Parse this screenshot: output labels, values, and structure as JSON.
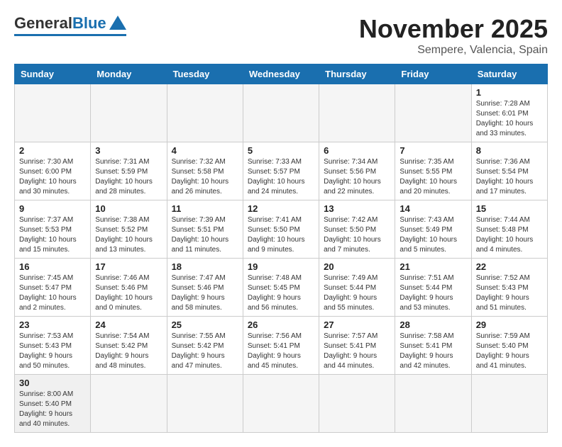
{
  "logo": {
    "general": "General",
    "blue": "Blue"
  },
  "header": {
    "title": "November 2025",
    "subtitle": "Sempere, Valencia, Spain"
  },
  "weekdays": [
    "Sunday",
    "Monday",
    "Tuesday",
    "Wednesday",
    "Thursday",
    "Friday",
    "Saturday"
  ],
  "weeks": [
    [
      {
        "day": "",
        "info": ""
      },
      {
        "day": "",
        "info": ""
      },
      {
        "day": "",
        "info": ""
      },
      {
        "day": "",
        "info": ""
      },
      {
        "day": "",
        "info": ""
      },
      {
        "day": "",
        "info": ""
      },
      {
        "day": "1",
        "info": "Sunrise: 7:28 AM\nSunset: 6:01 PM\nDaylight: 10 hours and 33 minutes."
      }
    ],
    [
      {
        "day": "2",
        "info": "Sunrise: 7:30 AM\nSunset: 6:00 PM\nDaylight: 10 hours and 30 minutes."
      },
      {
        "day": "3",
        "info": "Sunrise: 7:31 AM\nSunset: 5:59 PM\nDaylight: 10 hours and 28 minutes."
      },
      {
        "day": "4",
        "info": "Sunrise: 7:32 AM\nSunset: 5:58 PM\nDaylight: 10 hours and 26 minutes."
      },
      {
        "day": "5",
        "info": "Sunrise: 7:33 AM\nSunset: 5:57 PM\nDaylight: 10 hours and 24 minutes."
      },
      {
        "day": "6",
        "info": "Sunrise: 7:34 AM\nSunset: 5:56 PM\nDaylight: 10 hours and 22 minutes."
      },
      {
        "day": "7",
        "info": "Sunrise: 7:35 AM\nSunset: 5:55 PM\nDaylight: 10 hours and 20 minutes."
      },
      {
        "day": "8",
        "info": "Sunrise: 7:36 AM\nSunset: 5:54 PM\nDaylight: 10 hours and 17 minutes."
      }
    ],
    [
      {
        "day": "9",
        "info": "Sunrise: 7:37 AM\nSunset: 5:53 PM\nDaylight: 10 hours and 15 minutes."
      },
      {
        "day": "10",
        "info": "Sunrise: 7:38 AM\nSunset: 5:52 PM\nDaylight: 10 hours and 13 minutes."
      },
      {
        "day": "11",
        "info": "Sunrise: 7:39 AM\nSunset: 5:51 PM\nDaylight: 10 hours and 11 minutes."
      },
      {
        "day": "12",
        "info": "Sunrise: 7:41 AM\nSunset: 5:50 PM\nDaylight: 10 hours and 9 minutes."
      },
      {
        "day": "13",
        "info": "Sunrise: 7:42 AM\nSunset: 5:50 PM\nDaylight: 10 hours and 7 minutes."
      },
      {
        "day": "14",
        "info": "Sunrise: 7:43 AM\nSunset: 5:49 PM\nDaylight: 10 hours and 5 minutes."
      },
      {
        "day": "15",
        "info": "Sunrise: 7:44 AM\nSunset: 5:48 PM\nDaylight: 10 hours and 4 minutes."
      }
    ],
    [
      {
        "day": "16",
        "info": "Sunrise: 7:45 AM\nSunset: 5:47 PM\nDaylight: 10 hours and 2 minutes."
      },
      {
        "day": "17",
        "info": "Sunrise: 7:46 AM\nSunset: 5:46 PM\nDaylight: 10 hours and 0 minutes."
      },
      {
        "day": "18",
        "info": "Sunrise: 7:47 AM\nSunset: 5:46 PM\nDaylight: 9 hours and 58 minutes."
      },
      {
        "day": "19",
        "info": "Sunrise: 7:48 AM\nSunset: 5:45 PM\nDaylight: 9 hours and 56 minutes."
      },
      {
        "day": "20",
        "info": "Sunrise: 7:49 AM\nSunset: 5:44 PM\nDaylight: 9 hours and 55 minutes."
      },
      {
        "day": "21",
        "info": "Sunrise: 7:51 AM\nSunset: 5:44 PM\nDaylight: 9 hours and 53 minutes."
      },
      {
        "day": "22",
        "info": "Sunrise: 7:52 AM\nSunset: 5:43 PM\nDaylight: 9 hours and 51 minutes."
      }
    ],
    [
      {
        "day": "23",
        "info": "Sunrise: 7:53 AM\nSunset: 5:43 PM\nDaylight: 9 hours and 50 minutes."
      },
      {
        "day": "24",
        "info": "Sunrise: 7:54 AM\nSunset: 5:42 PM\nDaylight: 9 hours and 48 minutes."
      },
      {
        "day": "25",
        "info": "Sunrise: 7:55 AM\nSunset: 5:42 PM\nDaylight: 9 hours and 47 minutes."
      },
      {
        "day": "26",
        "info": "Sunrise: 7:56 AM\nSunset: 5:41 PM\nDaylight: 9 hours and 45 minutes."
      },
      {
        "day": "27",
        "info": "Sunrise: 7:57 AM\nSunset: 5:41 PM\nDaylight: 9 hours and 44 minutes."
      },
      {
        "day": "28",
        "info": "Sunrise: 7:58 AM\nSunset: 5:41 PM\nDaylight: 9 hours and 42 minutes."
      },
      {
        "day": "29",
        "info": "Sunrise: 7:59 AM\nSunset: 5:40 PM\nDaylight: 9 hours and 41 minutes."
      }
    ],
    [
      {
        "day": "30",
        "info": "Sunrise: 8:00 AM\nSunset: 5:40 PM\nDaylight: 9 hours and 40 minutes."
      },
      {
        "day": "",
        "info": ""
      },
      {
        "day": "",
        "info": ""
      },
      {
        "day": "",
        "info": ""
      },
      {
        "day": "",
        "info": ""
      },
      {
        "day": "",
        "info": ""
      },
      {
        "day": "",
        "info": ""
      }
    ]
  ]
}
